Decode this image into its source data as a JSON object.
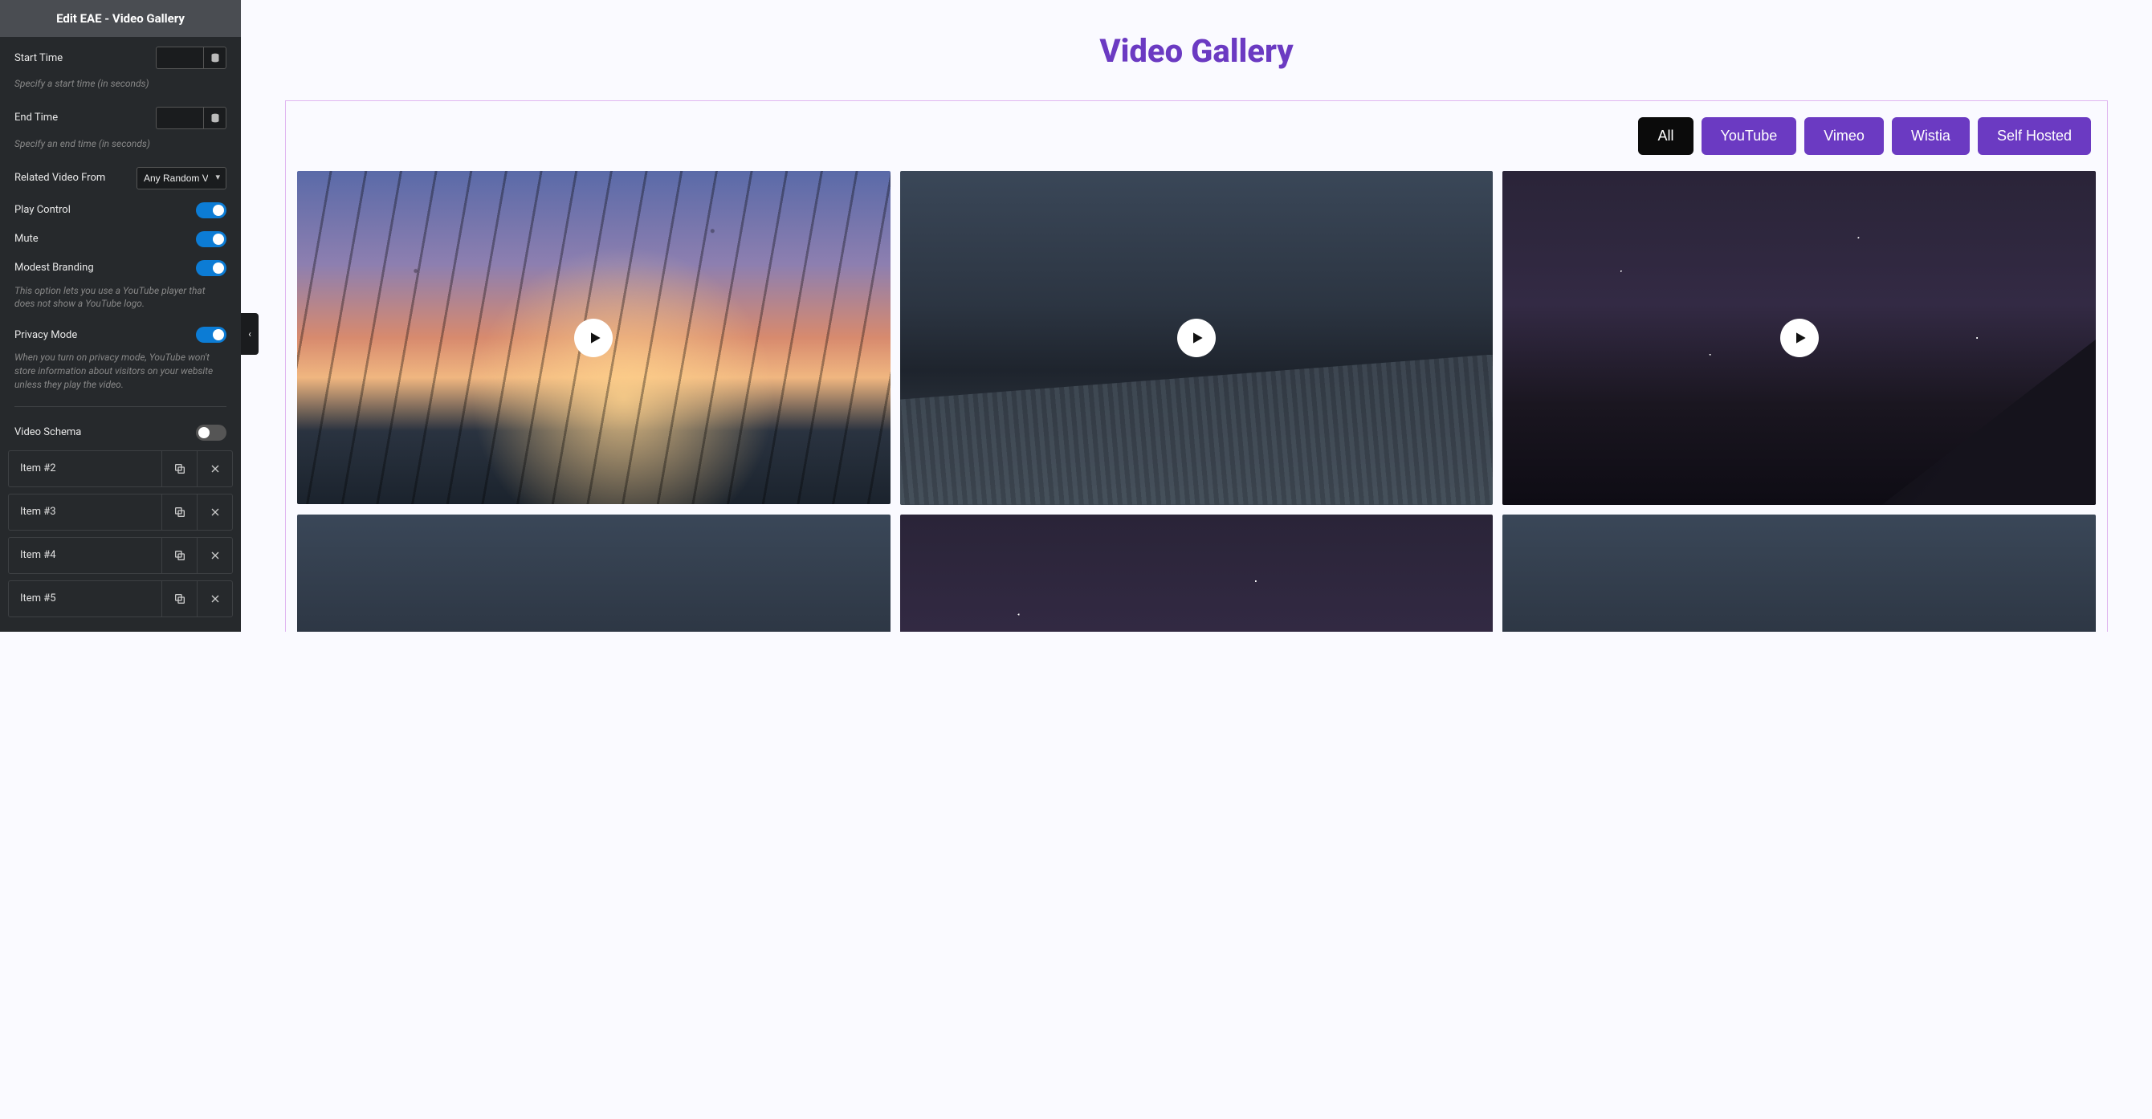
{
  "panel": {
    "title": "Edit EAE - Video Gallery",
    "start_time": {
      "label": "Start Time",
      "value": "",
      "help": "Specify a start time (in seconds)"
    },
    "end_time": {
      "label": "End Time",
      "value": "",
      "help": "Specify an end time (in seconds)"
    },
    "related": {
      "label": "Related Video From",
      "value": "Any Random Vi"
    },
    "toggles": {
      "play_control": {
        "label": "Play Control",
        "on": true
      },
      "mute": {
        "label": "Mute",
        "on": true
      },
      "modest_branding": {
        "label": "Modest Branding",
        "on": true,
        "help": "This option lets you use a YouTube player that does not show a YouTube logo."
      },
      "privacy_mode": {
        "label": "Privacy Mode",
        "on": true,
        "help": "When you turn on privacy mode, YouTube won't store information about visitors on your website unless they play the video."
      },
      "video_schema": {
        "label": "Video Schema",
        "on": false
      }
    },
    "items": [
      {
        "label": "Item #2"
      },
      {
        "label": "Item #3"
      },
      {
        "label": "Item #4"
      },
      {
        "label": "Item #5"
      }
    ]
  },
  "canvas": {
    "title": "Video Gallery",
    "filters": [
      {
        "label": "All",
        "active": true
      },
      {
        "label": "YouTube",
        "active": false
      },
      {
        "label": "Vimeo",
        "active": false
      },
      {
        "label": "Wistia",
        "active": false
      },
      {
        "label": "Self Hosted",
        "active": false
      }
    ],
    "thumbs": [
      {
        "style": "sunset"
      },
      {
        "style": "road"
      },
      {
        "style": "stars"
      },
      {
        "style": "road"
      },
      {
        "style": "stars"
      },
      {
        "style": "road"
      }
    ]
  },
  "colors": {
    "accent": "#6b3ac2",
    "toggle_on": "#0c7cd5"
  }
}
